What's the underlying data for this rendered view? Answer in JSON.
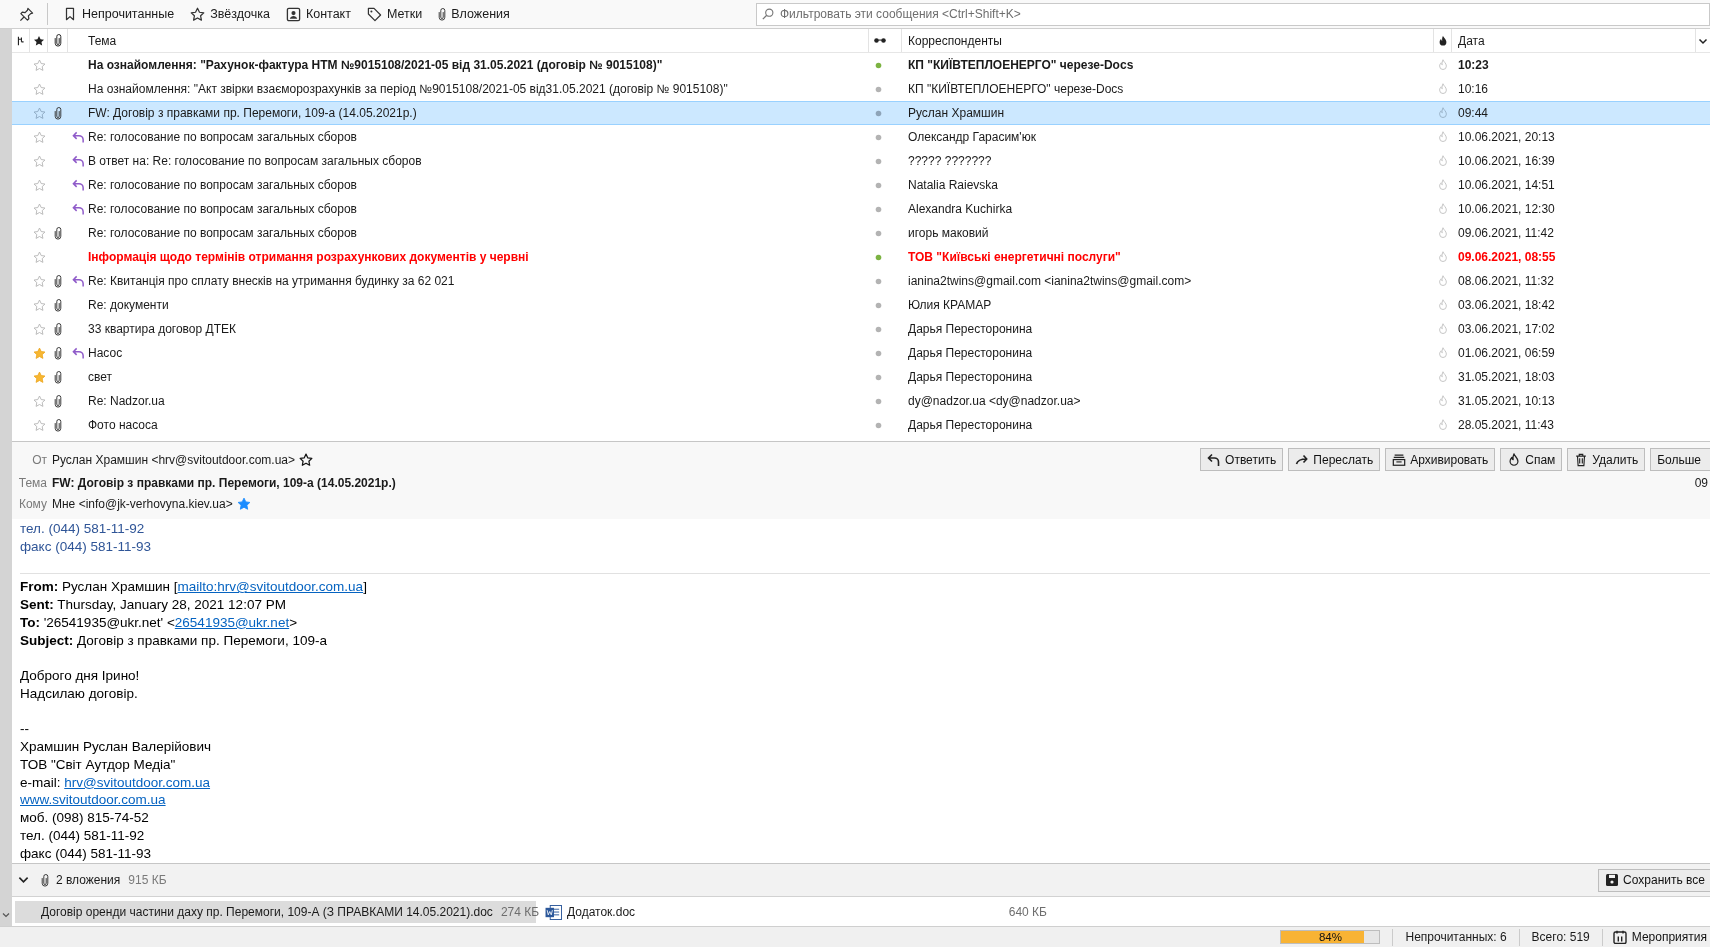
{
  "toolbar": {
    "quick_filters": [
      {
        "kind": "sticky",
        "selected": false
      },
      {
        "kind": "unread",
        "label": "Непрочитанные",
        "selected": false
      },
      {
        "kind": "starred",
        "label": "Звёздочка",
        "selected": false
      },
      {
        "kind": "contact",
        "label": "Контакт",
        "selected": false
      },
      {
        "kind": "tags",
        "label": "Метки",
        "selected": false
      },
      {
        "kind": "attachment",
        "label": "Вложения",
        "selected": false
      }
    ],
    "filter_field": {
      "placeholder": "Фильтровать эти сообщения <Ctrl+Shift+K>"
    }
  },
  "message_list": {
    "columns": {
      "subject": "Тема",
      "correspondents": "Корреспонденты",
      "date": "Дата"
    },
    "rows": [
      {
        "subject": "На ознайомлення: \"Рахунок-фактура НТМ №9015108/2021-05 від 31.05.2021 (договір № 9015108)\"",
        "correspondent": "КП \"КИЇВТЕПЛОЕНЕРГО\" черезе-Docs",
        "date": "10:23",
        "starred": false,
        "has_attachment": false,
        "replied": false,
        "unread": true,
        "selected": false
      },
      {
        "subject": "На ознайомлення: \"Акт звірки взаєморозрахунків за період №9015108/2021-05 від31.05.2021 (договір № 9015108)\"",
        "correspondent": "КП \"КИЇВТЕПЛОЕНЕРГО\" черезе-Docs",
        "date": "10:16",
        "starred": false,
        "has_attachment": false,
        "replied": false,
        "unread": false,
        "selected": false
      },
      {
        "subject": "FW: Договір з правками пр. Перемоги, 109-а (14.05.2021р.)",
        "correspondent": "Руслан Храмшин",
        "date": "09:44",
        "starred": false,
        "has_attachment": true,
        "replied": false,
        "unread": false,
        "selected": true
      },
      {
        "subject": "Re: голосование по вопросам загальных сборов",
        "correspondent": "Олександр Гарасим'юк",
        "date": "10.06.2021, 20:13",
        "starred": false,
        "has_attachment": false,
        "replied": true,
        "unread": false,
        "selected": false
      },
      {
        "subject": "В ответ на: Re: голосование по вопросам загальных сборов",
        "correspondent": "????? ???????",
        "date": "10.06.2021, 16:39",
        "starred": false,
        "has_attachment": false,
        "replied": true,
        "unread": false,
        "selected": false
      },
      {
        "subject": "Re: голосование по вопросам загальных сборов",
        "correspondent": "Natalia Raievska",
        "date": "10.06.2021, 14:51",
        "starred": false,
        "has_attachment": false,
        "replied": true,
        "unread": false,
        "selected": false
      },
      {
        "subject": "Re: голосование по вопросам загальных сборов",
        "correspondent": "Alexandra Kuchirka",
        "date": "10.06.2021, 12:30",
        "starred": false,
        "has_attachment": false,
        "replied": true,
        "unread": false,
        "selected": false
      },
      {
        "subject": "Re: голосование по вопросам загальных сборов",
        "correspondent": "игорь маковий",
        "date": "09.06.2021, 11:42",
        "starred": false,
        "has_attachment": true,
        "replied": false,
        "unread": false,
        "selected": false
      },
      {
        "subject": "Інформація щодо термінів отримання розрахункових документів у червні",
        "correspondent": "ТОВ \"Київські енергетичні послуги\"",
        "date": "09.06.2021, 08:55",
        "starred": false,
        "has_attachment": false,
        "replied": false,
        "unread": true,
        "selected": false,
        "color": "#ff0000"
      },
      {
        "subject": "Re: Квитанція про сплату внесків на утримання будинку за 62 021",
        "correspondent": "ianina2twins@gmail.com <ianina2twins@gmail.com>",
        "date": "08.06.2021, 11:32",
        "starred": false,
        "has_attachment": true,
        "replied": true,
        "unread": false,
        "selected": false
      },
      {
        "subject": "Re: документи",
        "correspondent": "Юлия КРАМАР",
        "date": "03.06.2021, 18:42",
        "starred": false,
        "has_attachment": true,
        "replied": false,
        "unread": false,
        "selected": false
      },
      {
        "subject": "33 квартира договор ДТЕК",
        "correspondent": "Дарья Пересторонина",
        "date": "03.06.2021, 17:02",
        "starred": false,
        "has_attachment": true,
        "replied": false,
        "unread": false,
        "selected": false
      },
      {
        "subject": "Насос",
        "correspondent": "Дарья Пересторонина",
        "date": "01.06.2021, 06:59",
        "starred": true,
        "has_attachment": true,
        "replied": true,
        "unread": false,
        "selected": false
      },
      {
        "subject": "свет",
        "correspondent": "Дарья Пересторонина",
        "date": "31.05.2021, 18:03",
        "starred": true,
        "has_attachment": true,
        "replied": false,
        "unread": false,
        "selected": false
      },
      {
        "subject": "Re: Nadzor.ua",
        "correspondent": "dy@nadzor.ua <dy@nadzor.ua>",
        "date": "31.05.2021, 10:13",
        "starred": false,
        "has_attachment": true,
        "replied": false,
        "unread": false,
        "selected": false
      },
      {
        "subject": "Фото насоса",
        "correspondent": "Дарья Пересторонина",
        "date": "28.05.2021, 11:43",
        "starred": false,
        "has_attachment": true,
        "replied": false,
        "unread": false,
        "selected": false
      }
    ]
  },
  "message_header": {
    "from": {
      "label": "От",
      "value": "Руслан Храмшин <hrv@svitoutdoor.com.ua>",
      "in_address_book": false
    },
    "subject": {
      "label": "Тема",
      "value": "FW: Договір з правками пр. Перемоги, 109-а (14.05.2021р.)"
    },
    "to": {
      "label": "Кому",
      "value": "Мне <info@jk-verhovyna.kiev.ua>",
      "in_address_book": true
    },
    "date": "09",
    "buttons": [
      {
        "kind": "reply",
        "label": "Ответить"
      },
      {
        "kind": "forward",
        "label": "Переслать"
      },
      {
        "kind": "archive",
        "label": "Архивировать"
      },
      {
        "kind": "junk",
        "label": "Спам"
      },
      {
        "kind": "delete",
        "label": "Удалить"
      },
      {
        "kind": "more",
        "label": "Больше"
      }
    ]
  },
  "message_body": {
    "paragraphs": [
      {
        "kind": "quoted_signature",
        "lines": [
          [
            {
              "kind": "text",
              "text": "тел. (044) 581-11-92"
            }
          ],
          [
            {
              "kind": "text",
              "text": "факс (044) 581-11-93"
            }
          ]
        ]
      },
      {
        "kind": "forwarded_header",
        "lines": [
          [
            {
              "kind": "text",
              "text": "**From:** Руслан Храмшин ["
            },
            {
              "kind": "link",
              "text": "mailto:hrv@svitoutdoor.com.ua"
            },
            {
              "kind": "text",
              "text": "]"
            }
          ],
          [
            {
              "kind": "text",
              "text": "**Sent:** Thursday, January 28, 2021 12:07 PM"
            }
          ],
          [
            {
              "kind": "text",
              "text": "**To:** '26541935@ukr.net' <"
            },
            {
              "kind": "link",
              "text": "26541935@ukr.net"
            },
            {
              "kind": "text",
              "text": ">"
            }
          ],
          [
            {
              "kind": "text",
              "text": "**Subject:** Договір з правками пр. Перемоги, 109-а"
            }
          ]
        ]
      },
      {
        "kind": "text",
        "lines": [
          [
            {
              "kind": "text",
              "text": "Доброго дня Ірино!"
            }
          ],
          [
            {
              "kind": "text",
              "text": "Надсилаю договір."
            }
          ]
        ]
      },
      {
        "kind": "text",
        "lines": [
          [
            {
              "kind": "text",
              "text": "--"
            }
          ],
          [
            {
              "kind": "text",
              "text": "Храмшин Руслан Валерійович"
            }
          ],
          [
            {
              "kind": "text",
              "text": "ТОВ \"Світ Аутдор Медіа\""
            }
          ],
          [
            {
              "kind": "text",
              "text": "e-mail: "
            },
            {
              "kind": "link",
              "text": "hrv@svitoutdoor.com.ua"
            }
          ],
          [
            {
              "kind": "link",
              "text": "www.svitoutdoor.com.ua"
            }
          ],
          [
            {
              "kind": "text",
              "text": "моб. (098) 815-74-52"
            }
          ],
          [
            {
              "kind": "text",
              "text": "тел. (044) 581-11-92"
            }
          ],
          [
            {
              "kind": "text",
              "text": "факс (044) 581-11-93"
            }
          ]
        ]
      }
    ]
  },
  "attachments": {
    "expanded": true,
    "count_label": "2 вложения",
    "total_size": "915 КБ",
    "save_all_button": "Сохранить все",
    "items": [
      {
        "name": "Договір оренди частини даху пр. Перемоги, 109-А (З ПРАВКАМИ 14.05.2021).doc",
        "size": "274 КБ",
        "selected": true,
        "file_icon": false
      },
      {
        "name": "Додаток.doc",
        "size": "640 КБ",
        "selected": false,
        "file_icon": true
      }
    ]
  },
  "status_bar": {
    "progress": {
      "level": 0.84,
      "label": "84%"
    },
    "unread": "Непрочитанных: 6",
    "total": "Всего: 519",
    "events_button": "Мероприятия"
  }
}
